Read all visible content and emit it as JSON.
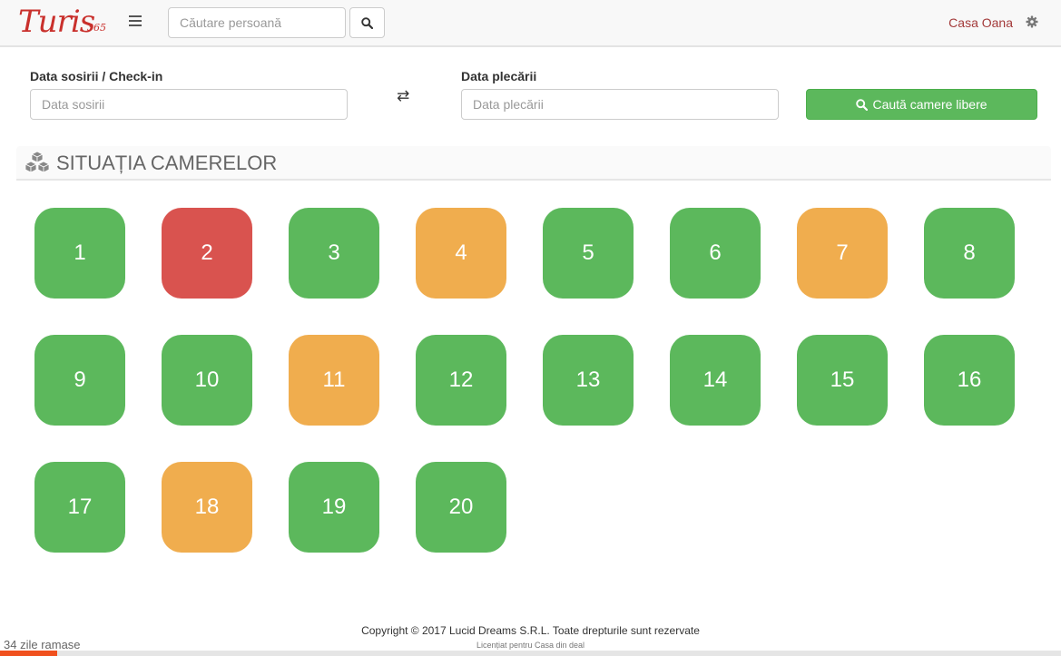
{
  "navbar": {
    "logo_text": "Turis",
    "logo_sub": "365",
    "search_placeholder": "Căutare persoană",
    "user_name": "Casa Oana"
  },
  "form": {
    "checkin_label": "Data sosirii / Check-in",
    "checkin_placeholder": "Data sosirii",
    "checkout_label": "Data plecării",
    "checkout_placeholder": "Data plecării",
    "swap_glyph": "⇄",
    "search_button_label": "Caută camere libere"
  },
  "section": {
    "title": "SITUAȚIA CAMERELOR"
  },
  "rooms": [
    {
      "number": "1",
      "status": "free"
    },
    {
      "number": "2",
      "status": "occupied"
    },
    {
      "number": "3",
      "status": "free"
    },
    {
      "number": "4",
      "status": "pending"
    },
    {
      "number": "5",
      "status": "free"
    },
    {
      "number": "6",
      "status": "free"
    },
    {
      "number": "7",
      "status": "pending"
    },
    {
      "number": "8",
      "status": "free"
    },
    {
      "number": "9",
      "status": "free"
    },
    {
      "number": "10",
      "status": "free"
    },
    {
      "number": "11",
      "status": "pending"
    },
    {
      "number": "12",
      "status": "free"
    },
    {
      "number": "13",
      "status": "free"
    },
    {
      "number": "14",
      "status": "free"
    },
    {
      "number": "15",
      "status": "free"
    },
    {
      "number": "16",
      "status": "free"
    },
    {
      "number": "17",
      "status": "free"
    },
    {
      "number": "18",
      "status": "pending"
    },
    {
      "number": "19",
      "status": "free"
    },
    {
      "number": "20",
      "status": "free"
    }
  ],
  "colors": {
    "free": "#5cb85c",
    "occupied": "#d9534f",
    "pending": "#f0ad4e",
    "brand": "#c9302c",
    "progress": "#f0501e"
  },
  "footer": {
    "copyright": "Copyright © 2017 Lucid Dreams S.R.L. Toate drepturile sunt rezervate",
    "license": "Licențiat pentru Casa din deal",
    "days_left": "34 zile ramase",
    "trial_progress": 0.054
  }
}
